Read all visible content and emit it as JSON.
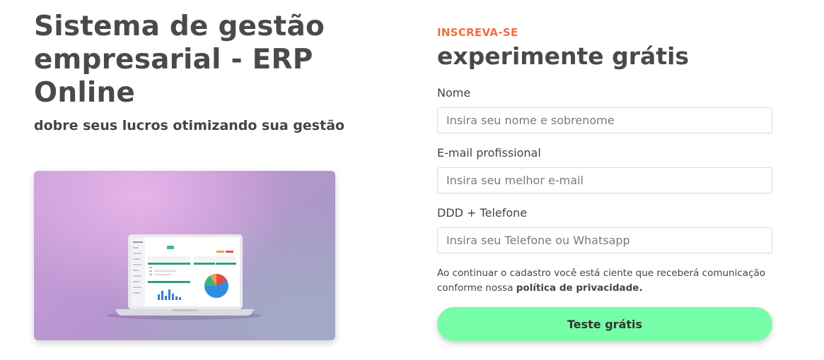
{
  "hero": {
    "title": "Sistema de gestão empresarial - ERP Online",
    "subtitle": "dobre seus lucros otimizando sua gestão",
    "image_alt": "laptop-dashboard-illustration"
  },
  "signup": {
    "eyebrow": "INSCREVA-SE",
    "title": "experimente grátis",
    "fields": [
      {
        "label": "Nome",
        "placeholder": "Insira seu nome e sobrenome",
        "value": ""
      },
      {
        "label": "E-mail profissional",
        "placeholder": "Insira seu melhor e-mail",
        "value": ""
      },
      {
        "label": "DDD + Telefone",
        "placeholder": "Insira seu Telefone ou Whatsapp",
        "value": ""
      }
    ],
    "consent_text": "Ao continuar o cadastro você está ciente que receberá comunicação conforme nossa ",
    "privacy_link": "política de privacidade.",
    "submit_label": "Teste grátis"
  },
  "colors": {
    "eyebrow": "#f26d3d",
    "cta_background": "#76fda8",
    "text": "#4a4a4a"
  }
}
